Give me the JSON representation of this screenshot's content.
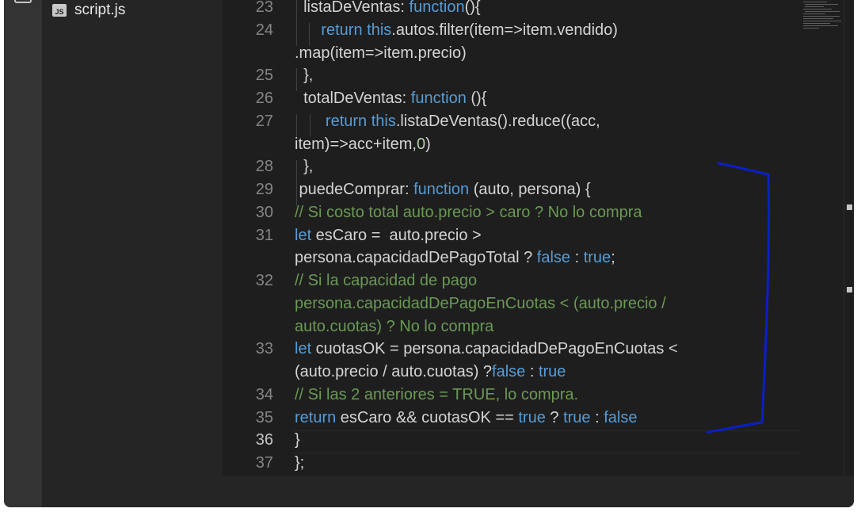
{
  "sidebar": {
    "file_icon": "js-file-icon",
    "file_icon_text": "JS",
    "file_name": "script.js"
  },
  "editor": {
    "lines": [
      {
        "num": "23",
        "tokens": [
          {
            "t": "  listaDeVentas: "
          },
          {
            "t": "function",
            "c": "kw"
          },
          {
            "t": "(){"
          }
        ]
      },
      {
        "num": "24",
        "tokens": [
          {
            "t": "      "
          },
          {
            "t": "return",
            "c": "kw"
          },
          {
            "t": " "
          },
          {
            "t": "this",
            "c": "kw"
          },
          {
            "t": ".autos.filter(item=>item.vendido)"
          }
        ]
      },
      {
        "num": "",
        "tokens": [
          {
            "t": ".map(item=>item.precio)"
          }
        ]
      },
      {
        "num": "25",
        "tokens": [
          {
            "t": "  },"
          }
        ]
      },
      {
        "num": "26",
        "tokens": [
          {
            "t": "  totalDeVentas: "
          },
          {
            "t": "function",
            "c": "kw"
          },
          {
            "t": " (){"
          }
        ]
      },
      {
        "num": "27",
        "tokens": [
          {
            "t": "       "
          },
          {
            "t": "return",
            "c": "kw"
          },
          {
            "t": " "
          },
          {
            "t": "this",
            "c": "kw"
          },
          {
            "t": ".listaDeVentas().reduce((acc,"
          }
        ]
      },
      {
        "num": "",
        "tokens": [
          {
            "t": "item)=>acc+item,"
          },
          {
            "t": "0",
            "c": "num"
          },
          {
            "t": ")"
          }
        ]
      },
      {
        "num": "28",
        "tokens": [
          {
            "t": "  },"
          }
        ]
      },
      {
        "num": "29",
        "tokens": [
          {
            "t": " puedeComprar: "
          },
          {
            "t": "function",
            "c": "kw"
          },
          {
            "t": " (auto, persona) {"
          }
        ]
      },
      {
        "num": "30",
        "tokens": [
          {
            "t": "// Si costo total auto.precio > caro ? No lo compra",
            "c": "cm"
          }
        ]
      },
      {
        "num": "31",
        "tokens": [
          {
            "t": "let",
            "c": "kw"
          },
          {
            "t": " esCaro =  auto.precio >"
          }
        ]
      },
      {
        "num": "",
        "tokens": [
          {
            "t": "persona.capacidadDePagoTotal ? "
          },
          {
            "t": "false",
            "c": "kw"
          },
          {
            "t": " : "
          },
          {
            "t": "true",
            "c": "kw"
          },
          {
            "t": ";"
          }
        ]
      },
      {
        "num": "32",
        "tokens": [
          {
            "t": "// Si la capacidad de pago",
            "c": "cm"
          }
        ]
      },
      {
        "num": "",
        "tokens": [
          {
            "t": "persona.capacidadDePagoEnCuotas < (auto.precio /",
            "c": "cm"
          }
        ]
      },
      {
        "num": "",
        "tokens": [
          {
            "t": "auto.cuotas) ? No lo compra",
            "c": "cm"
          }
        ]
      },
      {
        "num": "33",
        "tokens": [
          {
            "t": "let",
            "c": "kw"
          },
          {
            "t": " cuotasOK = persona.capacidadDePagoEnCuotas <"
          }
        ]
      },
      {
        "num": "",
        "tokens": [
          {
            "t": "(auto.precio / auto.cuotas) ?"
          },
          {
            "t": "false",
            "c": "kw"
          },
          {
            "t": " : "
          },
          {
            "t": "true",
            "c": "kw"
          }
        ]
      },
      {
        "num": "34",
        "tokens": [
          {
            "t": "// Si las 2 anteriores = TRUE, lo compra.",
            "c": "cm"
          }
        ]
      },
      {
        "num": "35",
        "tokens": [
          {
            "t": "return",
            "c": "kw"
          },
          {
            "t": " esCaro && cuotasOK == "
          },
          {
            "t": "true",
            "c": "kw"
          },
          {
            "t": " ? "
          },
          {
            "t": "true",
            "c": "kw"
          },
          {
            "t": " : "
          },
          {
            "t": "false",
            "c": "kw"
          }
        ]
      },
      {
        "num": "36",
        "tokens": [
          {
            "t": "}"
          }
        ],
        "active": true
      },
      {
        "num": "37",
        "tokens": [
          {
            "t": "};"
          }
        ]
      }
    ]
  },
  "colors": {
    "keyword": "#569cd6",
    "comment": "#6a9955",
    "number": "#b5cea8",
    "text": "#d4d4d4",
    "annotation": "#0a1fc8"
  }
}
